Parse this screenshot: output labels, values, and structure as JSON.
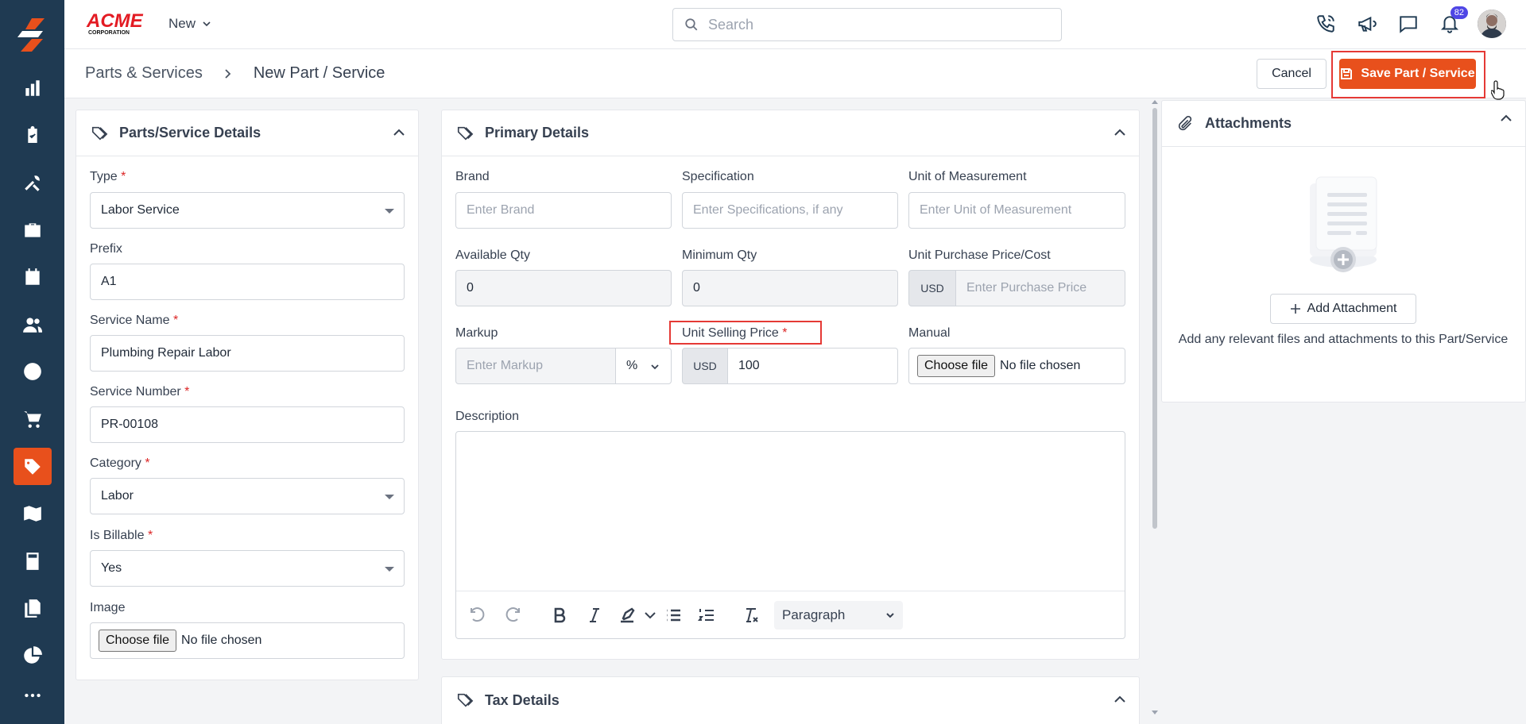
{
  "sidebar": {
    "items": [
      {
        "icon": "chart-bar-icon",
        "active": false
      },
      {
        "icon": "clipboard-check-icon",
        "active": false
      },
      {
        "icon": "tools-icon",
        "active": false
      },
      {
        "icon": "briefcase-icon",
        "active": false
      },
      {
        "icon": "calendar-icon",
        "active": false
      },
      {
        "icon": "users-icon",
        "active": false
      },
      {
        "icon": "clock-icon",
        "active": false
      },
      {
        "icon": "cart-icon",
        "active": false
      },
      {
        "icon": "tag-icon",
        "active": true
      },
      {
        "icon": "map-icon",
        "active": false
      },
      {
        "icon": "calculator-icon",
        "active": false
      },
      {
        "icon": "documents-icon",
        "active": false
      },
      {
        "icon": "pie-chart-icon",
        "active": false
      }
    ]
  },
  "header": {
    "brand_name": "ACME",
    "brand_sub": "CORPORATION",
    "new_label": "New",
    "search_placeholder": "Search",
    "notification_count": "82"
  },
  "breadcrumb": {
    "parent": "Parts & Services",
    "current": "New Part / Service"
  },
  "actions": {
    "cancel_label": "Cancel",
    "save_label": "Save Part / Service"
  },
  "details_card": {
    "title": "Parts/Service Details",
    "type_label": "Type",
    "type_value": "Labor Service",
    "prefix_label": "Prefix",
    "prefix_value": "A1",
    "service_name_label": "Service Name",
    "service_name_value": "Plumbing Repair Labor",
    "service_number_label": "Service Number",
    "service_number_value": "PR-00108",
    "category_label": "Category",
    "category_value": "Labor",
    "billable_label": "Is Billable",
    "billable_value": "Yes",
    "image_label": "Image",
    "choose_file": "Choose file",
    "no_file": "No file chosen"
  },
  "primary_card": {
    "title": "Primary Details",
    "brand_label": "Brand",
    "brand_placeholder": "Enter Brand",
    "spec_label": "Specification",
    "spec_placeholder": "Enter Specifications, if any",
    "uom_label": "Unit of Measurement",
    "uom_placeholder": "Enter Unit of Measurement",
    "avail_label": "Available Qty",
    "avail_value": "0",
    "min_label": "Minimum Qty",
    "min_value": "0",
    "purchase_label": "Unit Purchase Price/Cost",
    "purchase_currency": "USD",
    "purchase_placeholder": "Enter Purchase Price",
    "markup_label": "Markup",
    "markup_placeholder": "Enter Markup",
    "markup_unit": "%",
    "selling_label": "Unit Selling Price",
    "selling_currency": "USD",
    "selling_value": "100",
    "manual_label": "Manual",
    "choose_file": "Choose file",
    "no_file": "No file chosen",
    "description_label": "Description",
    "paragraph_label": "Paragraph"
  },
  "tax_card": {
    "title": "Tax Details"
  },
  "attachments_card": {
    "title": "Attachments",
    "add_label": "Add Attachment",
    "help_text": "Add any relevant files and attachments to this Part/Service"
  }
}
